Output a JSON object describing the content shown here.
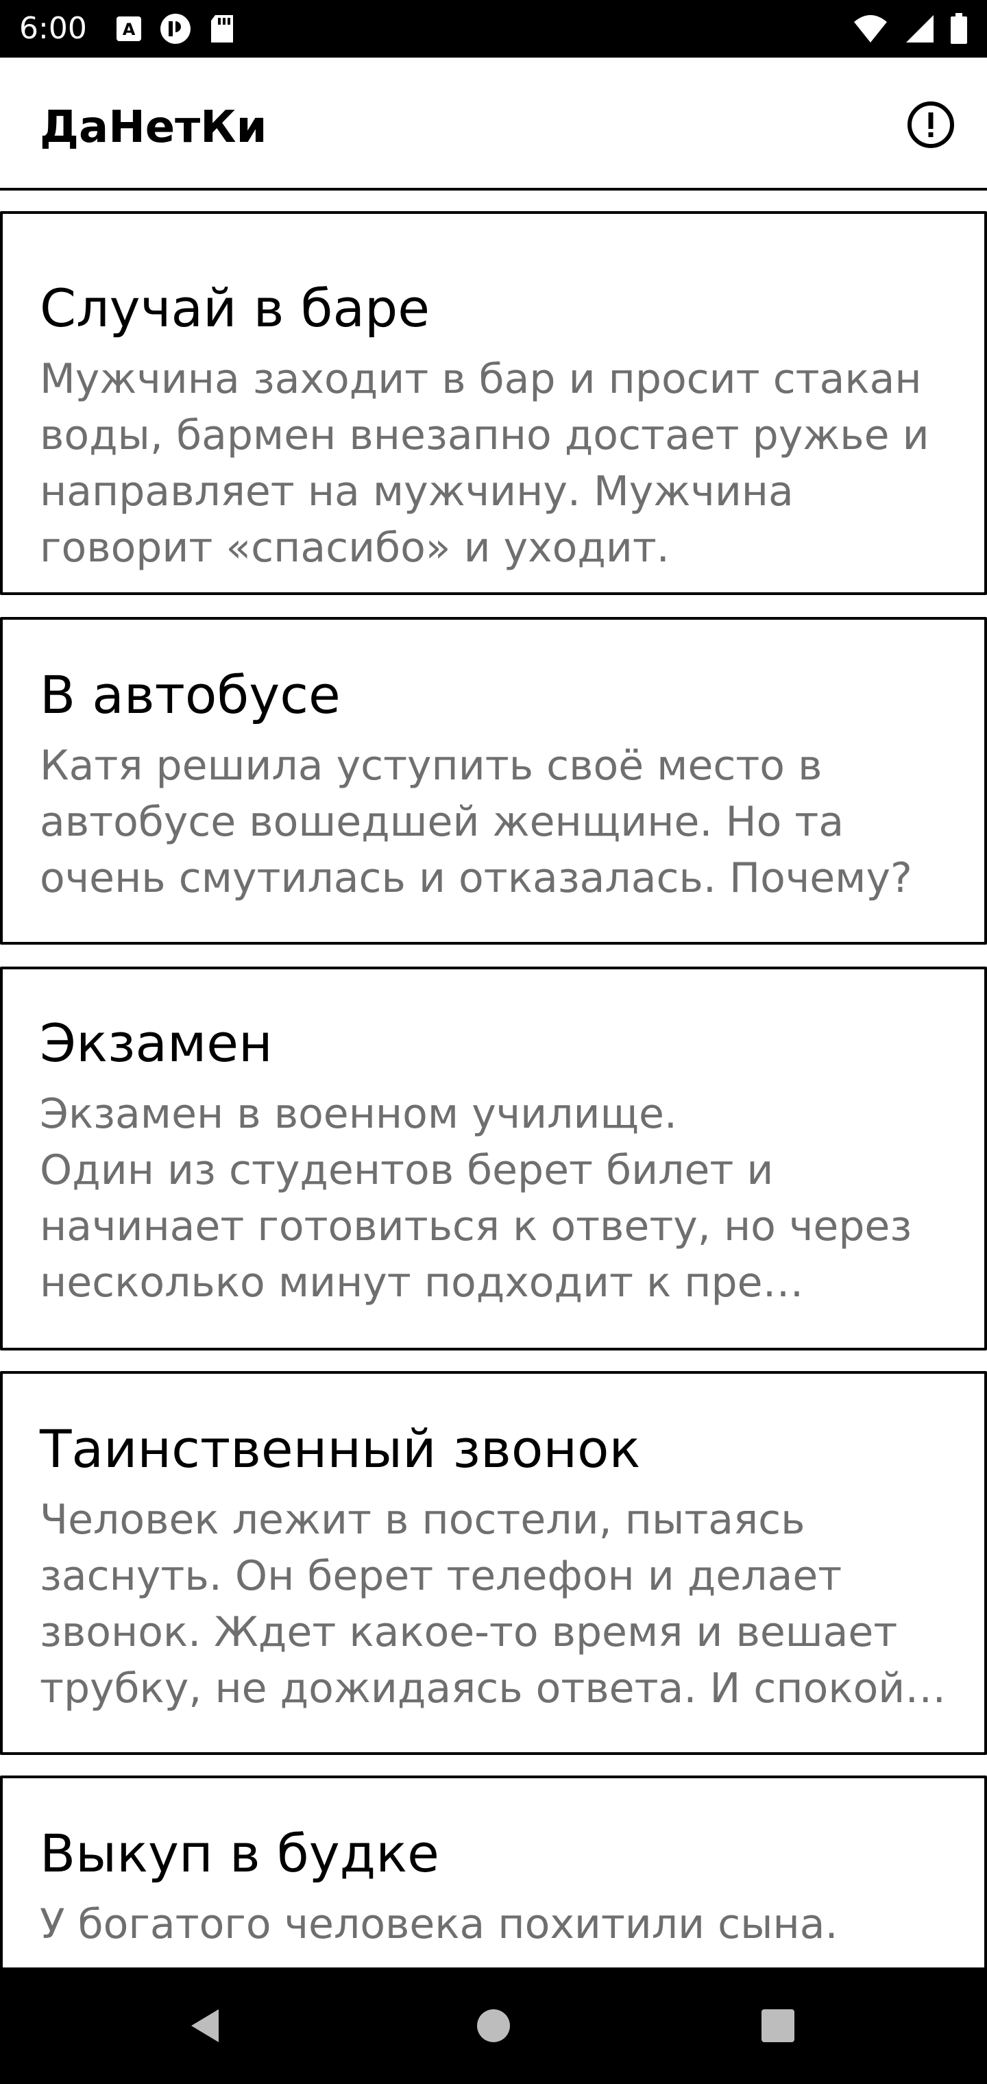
{
  "status_bar": {
    "time": "6:00",
    "left_icons": [
      "a-badge-icon",
      "sync-icon",
      "sd-card-icon"
    ],
    "right_icons": [
      "wifi-icon",
      "cell-signal-icon",
      "battery-icon"
    ]
  },
  "app_bar": {
    "title": "ДаНетКи",
    "info_icon": "alert-circle-icon"
  },
  "cards": [
    {
      "title": "Случай в баре",
      "description": "Мужчина заходит в бар и просит стакан воды, бармен внезапно достает ружье и направляет на мужчину. Мужчина говорит «спасибо» и уходит."
    },
    {
      "title": "В автобусе",
      "description": "Катя решила уступить своё место в автобусе вошедшей женщине. Но та очень смутилась и отказалась. Почему?"
    },
    {
      "title": "Экзамен",
      "description": "Экзамен в военном училище.\nОдин из студентов берет билет и начинает готовиться к ответу, но через несколько минут подходит к пре…"
    },
    {
      "title": "Таинственный звонок",
      "description": "Человек лежит в постели, пытаясь заснуть. Он берет телефон и делает звонок. Ждет какое-то время и вешает трубку, не дожидаясь ответа. И спокой…"
    },
    {
      "title": "Выкуп в будке",
      "description": "У богатого человека похитили сына."
    }
  ],
  "nav_bar": {
    "back_icon": "back-triangle-icon",
    "home_icon": "home-circle-icon",
    "recents_icon": "recents-square-icon"
  },
  "colors": {
    "status_bar_bg": "#000000",
    "app_bar_bg": "#ffffff",
    "title_text": "#000000",
    "description_text": "#6f6f6f",
    "card_border": "#000000",
    "nav_icon": "#bdbdbd"
  }
}
